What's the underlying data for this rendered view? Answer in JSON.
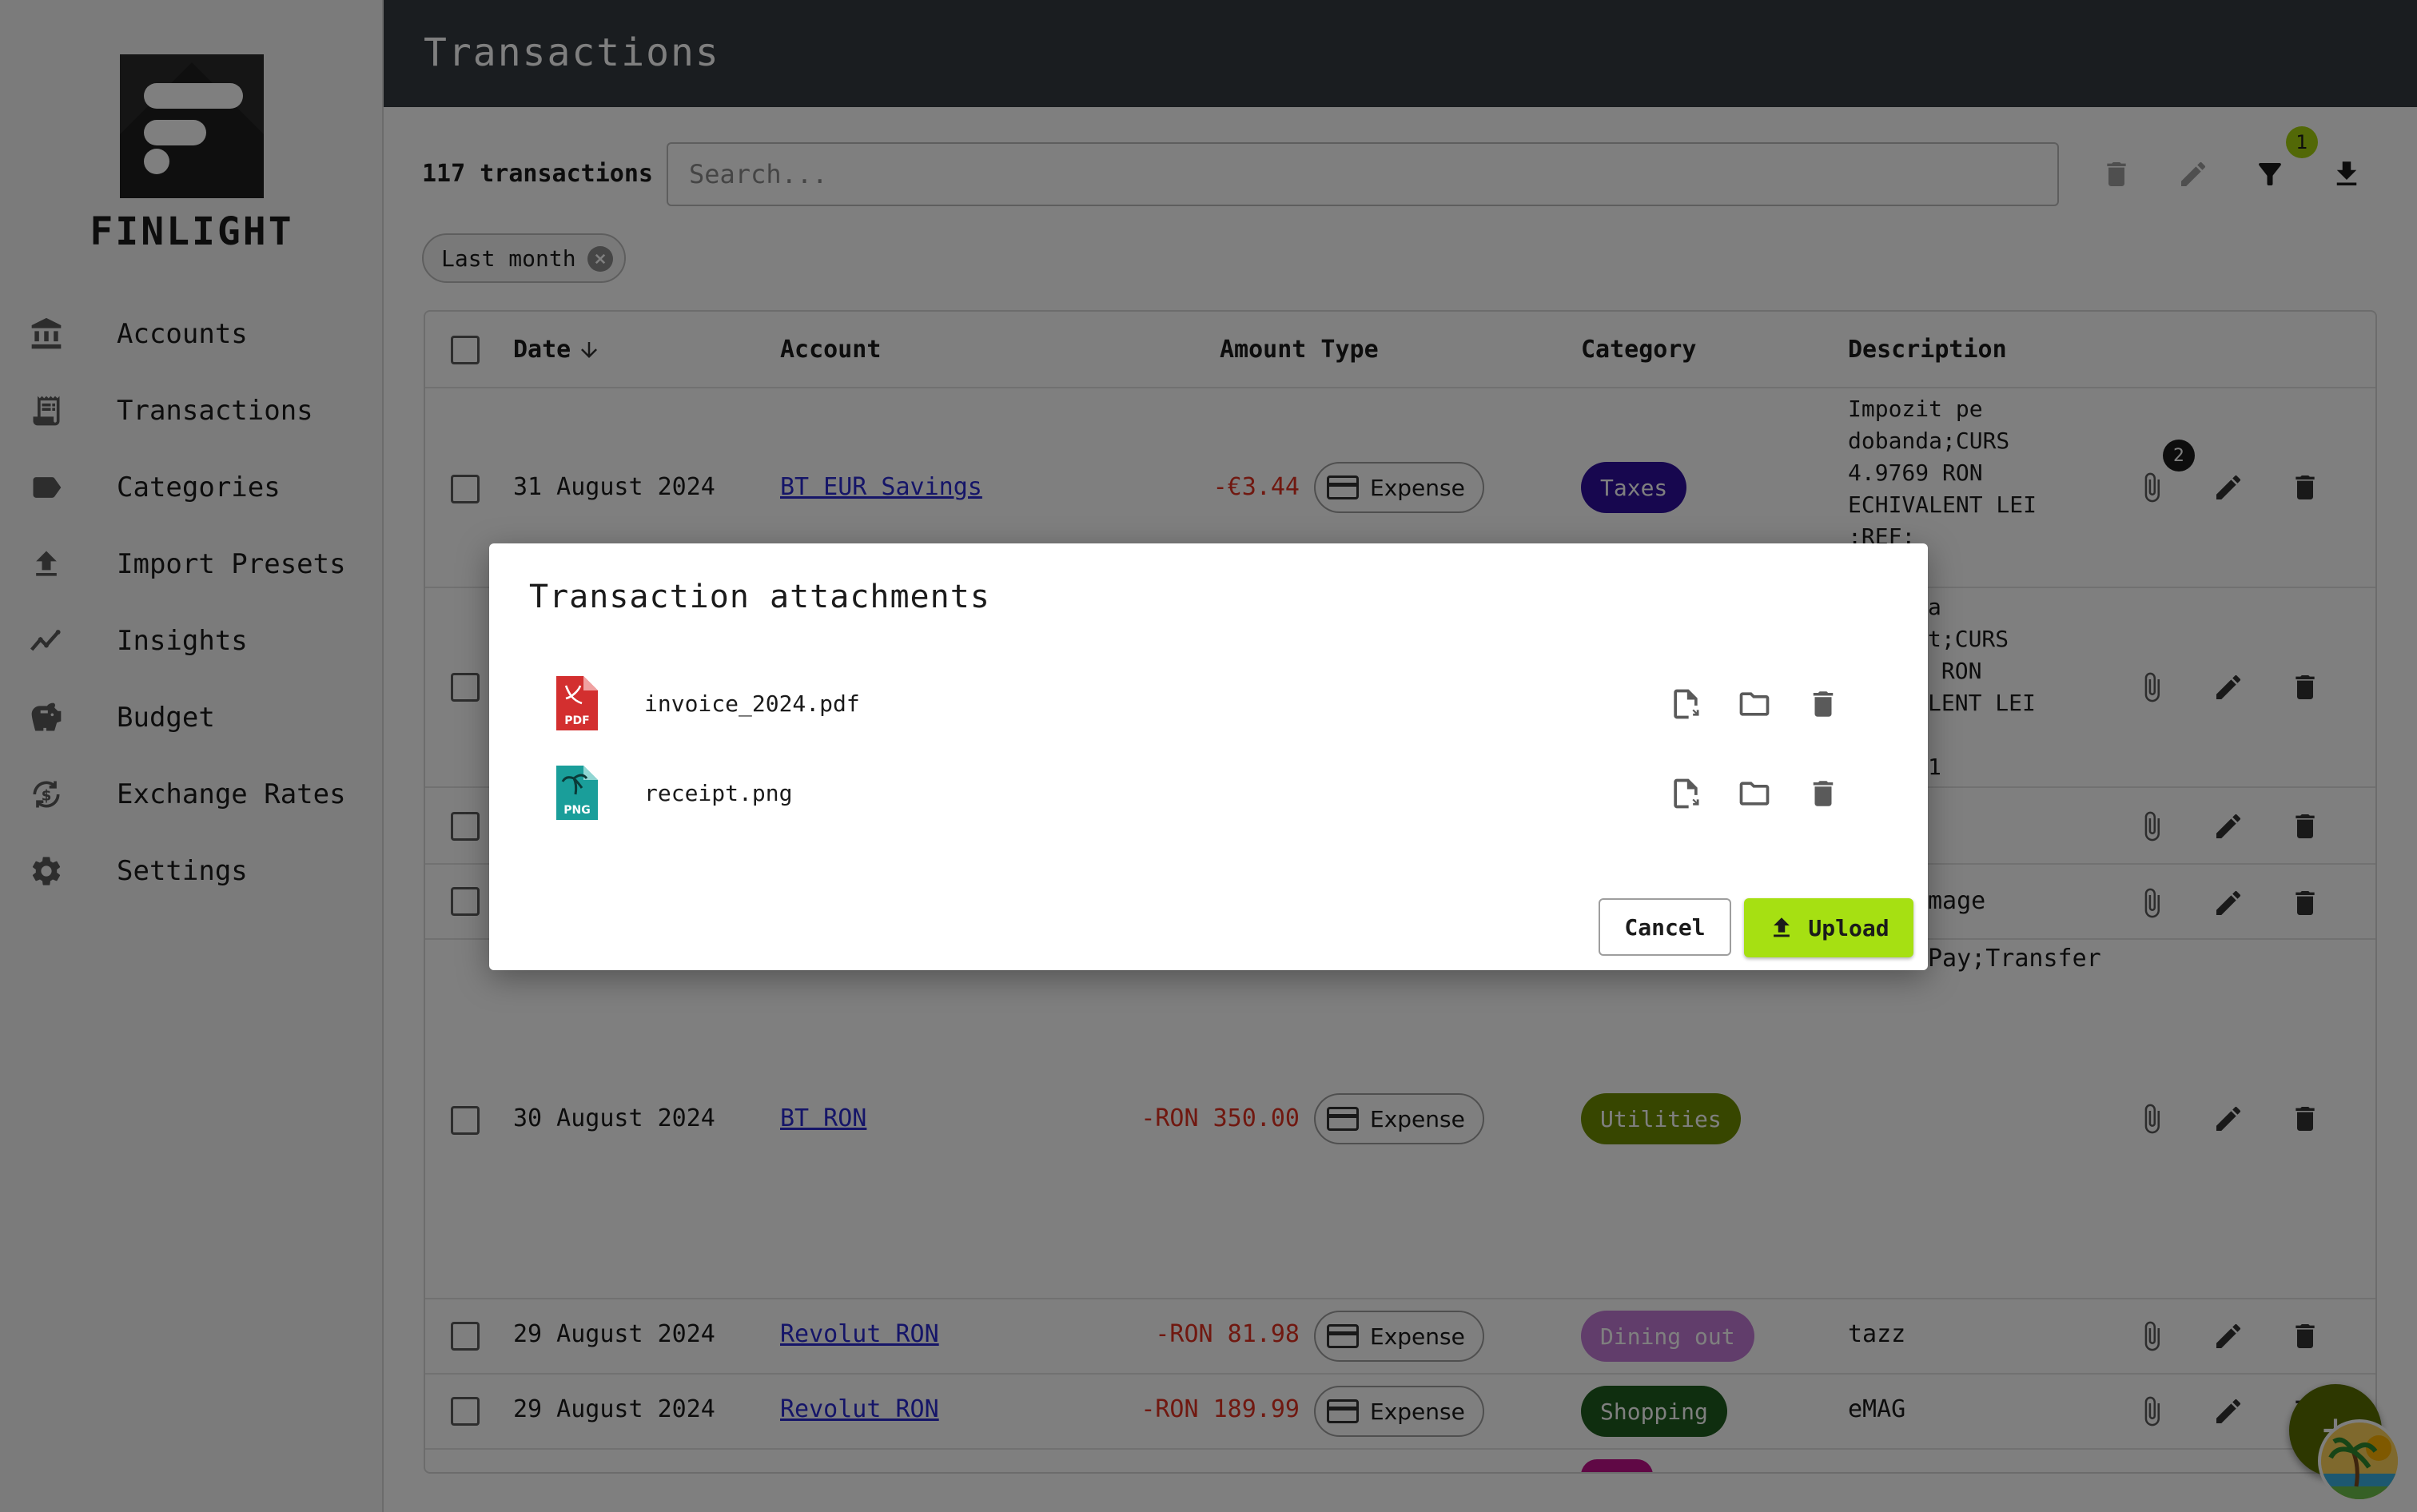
{
  "app": {
    "name": "FINLIGHT"
  },
  "sidebar": {
    "items": [
      {
        "label": "Accounts",
        "icon": "bank-icon"
      },
      {
        "label": "Transactions",
        "icon": "receipt-icon"
      },
      {
        "label": "Categories",
        "icon": "label-icon"
      },
      {
        "label": "Import Presets",
        "icon": "upload-icon"
      },
      {
        "label": "Insights",
        "icon": "trend-icon"
      },
      {
        "label": "Budget",
        "icon": "piggy-bank-icon"
      },
      {
        "label": "Exchange Rates",
        "icon": "currency-exchange-icon"
      },
      {
        "label": "Settings",
        "icon": "gear-icon"
      }
    ]
  },
  "header": {
    "title": "Transactions"
  },
  "toolbar": {
    "count": "117 transactions",
    "search_placeholder": "Search...",
    "filter_badge": "1"
  },
  "filters": {
    "chip_label": "Last month"
  },
  "table": {
    "headers": {
      "date": "Date",
      "account": "Account",
      "amount_type": "Amount Type",
      "category": "Category",
      "description": "Description"
    },
    "rows": [
      {
        "date": "31 August 2024",
        "account": "BT EUR Savings",
        "amount": "-€3.44",
        "type": "Expense",
        "category": "Taxes",
        "category_color": "#2e0f9e",
        "description": "Impozit pe\ndobanda;CURS\n4.9769 RON\nECHIVALENT LEI\n;REF:",
        "attachments_badge": "2"
      },
      {
        "date": "",
        "account": "",
        "amount": "",
        "type": "",
        "category": "",
        "category_color": "",
        "description": "a\nt;CURS\n RON\nLENT LEI\n\n1"
      },
      {
        "date": "",
        "account": "",
        "amount": "",
        "type": "",
        "category": "",
        "category_color": "",
        "description": ""
      },
      {
        "date": "",
        "account": "",
        "amount": "",
        "type": "",
        "category": "",
        "category_color": "",
        "description": "mage"
      },
      {
        "date": "30 August 2024",
        "account": "BT RON",
        "amount": "-RON 350.00",
        "type": "Expense",
        "category": "Utilities",
        "category_color": "#6e8c00",
        "description": "Pay;Transfer"
      },
      {
        "date": "29 August 2024",
        "account": "Revolut RON",
        "amount": "-RON 81.98",
        "type": "Expense",
        "category": "Dining out",
        "category_color": "#c27ad6",
        "description": "tazz"
      },
      {
        "date": "29 August 2024",
        "account": "Revolut RON",
        "amount": "-RON 189.99",
        "type": "Expense",
        "category": "Shopping",
        "category_color": "#1f5c1f",
        "description": "eMAG"
      }
    ]
  },
  "dialog": {
    "title": "Transaction attachments",
    "attachments": [
      {
        "name": "invoice_2024.pdf",
        "file_type": "PDF",
        "color": "#d32f2f"
      },
      {
        "name": "receipt.png",
        "file_type": "PNG",
        "color": "#1a9e9a"
      }
    ],
    "cancel_label": "Cancel",
    "upload_label": "Upload"
  },
  "colors": {
    "accent": "#a6e012",
    "topbar": "#343a40",
    "negative_amount": "#e03020",
    "link": "#2a2ad0"
  }
}
